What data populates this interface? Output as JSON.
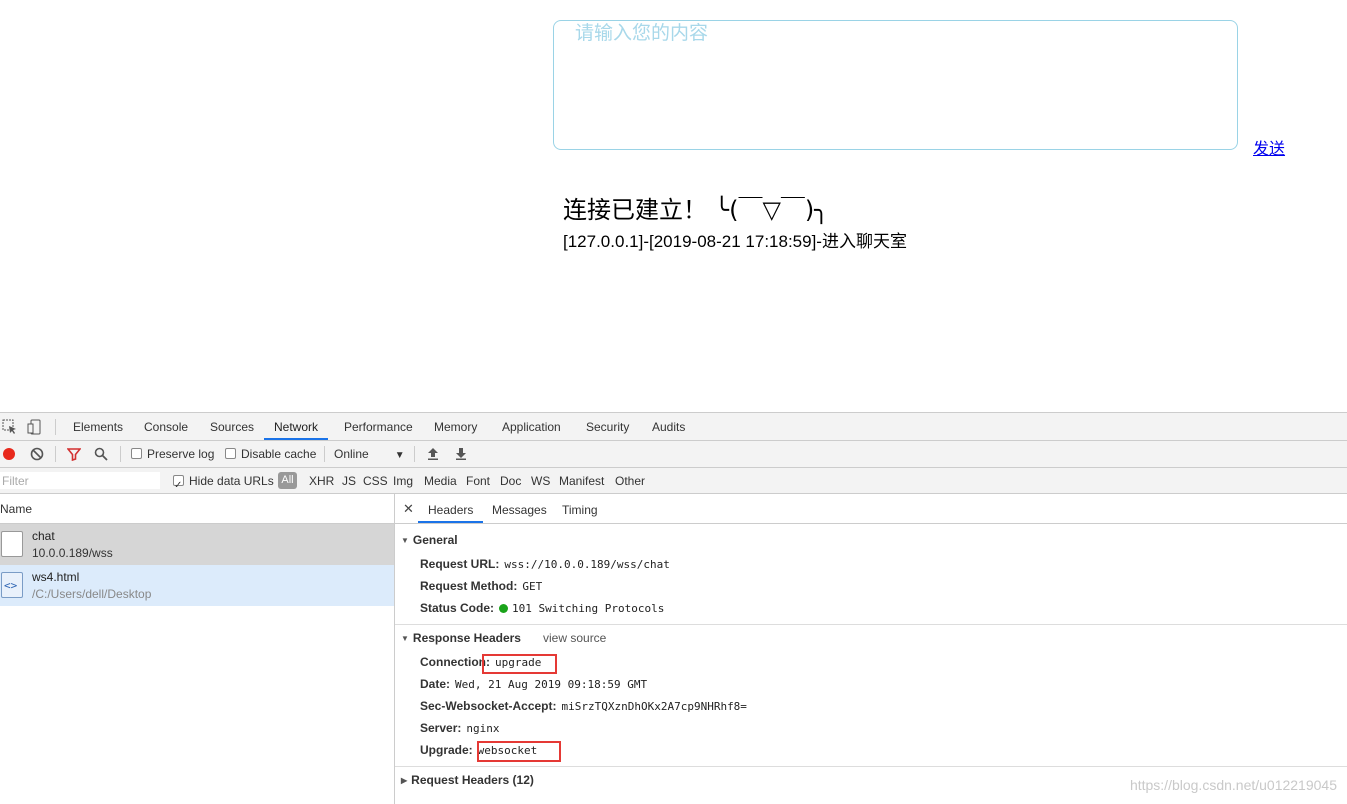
{
  "page": {
    "input_placeholder": "请输入您的内容",
    "send_label": "发送",
    "connection_status": "连接已建立！ ╰(￣▽￣)╮",
    "chat_line": "[127.0.0.1]-[2019-08-21 17:18:59]-进入聊天室"
  },
  "devtools": {
    "tabs": [
      "Elements",
      "Console",
      "Sources",
      "Network",
      "Performance",
      "Memory",
      "Application",
      "Security",
      "Audits"
    ],
    "active_tab": "Network",
    "toolbar": {
      "preserve_log": "Preserve log",
      "disable_cache": "Disable cache",
      "throttle": "Online"
    },
    "filter": {
      "placeholder": "Filter",
      "hide_data_urls": "Hide data URLs",
      "types": [
        "All",
        "XHR",
        "JS",
        "CSS",
        "Img",
        "Media",
        "Font",
        "Doc",
        "WS",
        "Manifest",
        "Other"
      ]
    },
    "requests_header": "Name",
    "requests": [
      {
        "name": "chat",
        "sub": "10.0.0.189/wss"
      },
      {
        "name": "ws4.html",
        "sub": "/C:/Users/dell/Desktop"
      }
    ],
    "detail_tabs": [
      "Headers",
      "Messages",
      "Timing"
    ],
    "general": {
      "title": "General",
      "rows": [
        {
          "key": "Request URL:",
          "value": "wss://10.0.0.189/wss/chat"
        },
        {
          "key": "Request Method:",
          "value": "GET"
        },
        {
          "key": "Status Code:",
          "value": "101 Switching Protocols"
        }
      ]
    },
    "response_headers": {
      "title": "Response Headers",
      "view_source": "view source",
      "rows": [
        {
          "key": "Connection:",
          "value": "upgrade"
        },
        {
          "key": "Date:",
          "value": "Wed, 21 Aug 2019 09:18:59 GMT"
        },
        {
          "key": "Sec-Websocket-Accept:",
          "value": "miSrzTQXznDhOKx2A7cp9NHRhf8="
        },
        {
          "key": "Server:",
          "value": "nginx"
        },
        {
          "key": "Upgrade:",
          "value": "websocket"
        }
      ]
    },
    "request_headers": {
      "title": "Request Headers (12)"
    }
  },
  "watermark": "https://blog.csdn.net/u012219045",
  "colors": {
    "accent": "#1a73e8",
    "record": "#e8291c",
    "highlight": "#e53935",
    "status_ok": "#1aa31a"
  }
}
